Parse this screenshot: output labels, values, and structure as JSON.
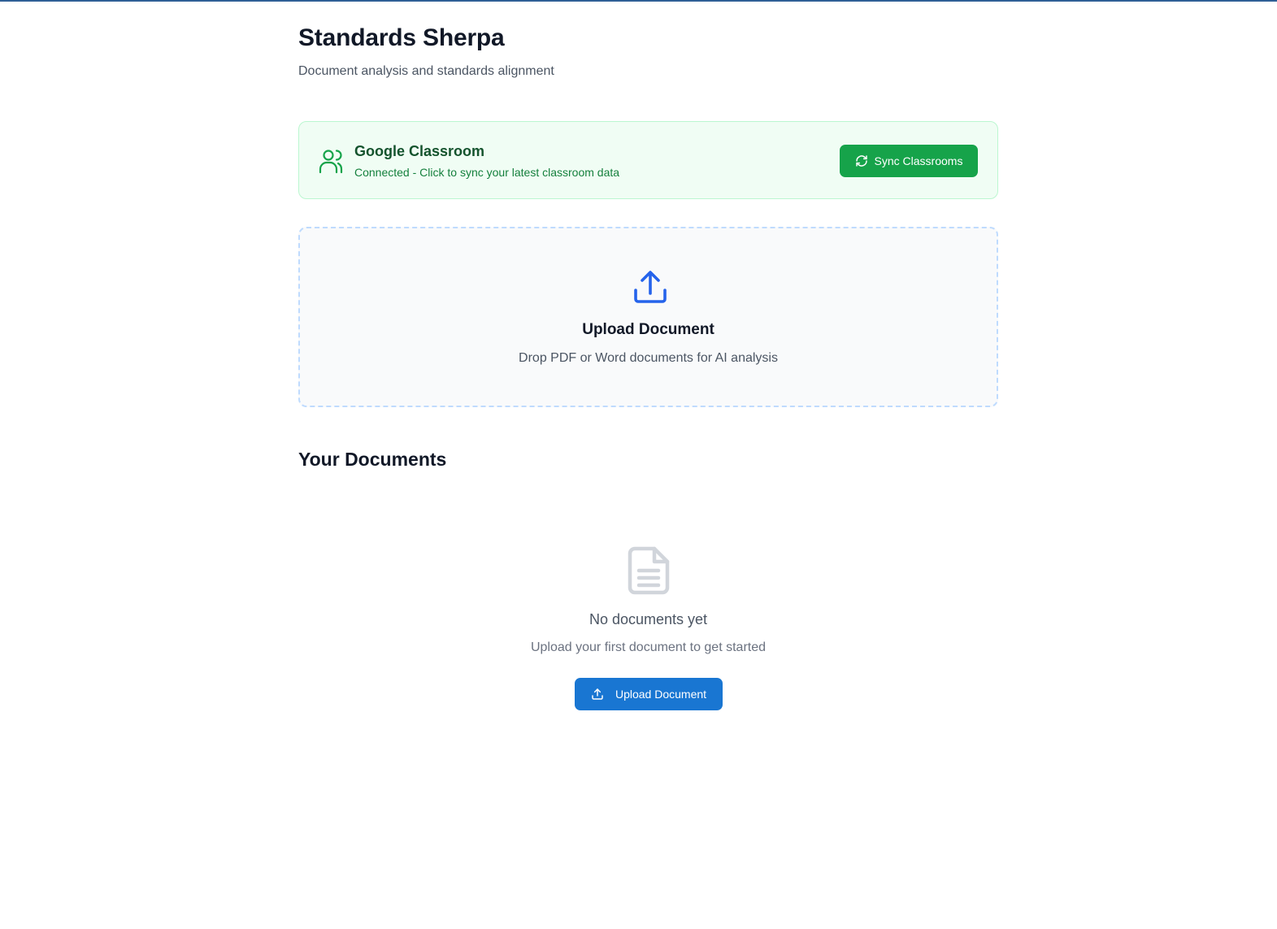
{
  "header": {
    "title": "Standards Sherpa",
    "subtitle": "Document analysis and standards alignment"
  },
  "google_classroom": {
    "title": "Google Classroom",
    "status": "Connected - Click to sync your latest classroom data",
    "sync_button_label": "Sync Classrooms",
    "icon": "users-icon",
    "sync_icon": "refresh-icon"
  },
  "upload_zone": {
    "title": "Upload Document",
    "description": "Drop PDF or Word documents for AI analysis",
    "icon": "upload-icon"
  },
  "documents": {
    "section_title": "Your Documents",
    "empty_title": "No documents yet",
    "empty_description": "Upload your first document to get started",
    "upload_button_label": "Upload Document",
    "empty_icon": "file-text-icon"
  },
  "colors": {
    "primary_blue": "#1976d2",
    "success_green": "#16a34a",
    "success_bg": "#f0fdf4",
    "success_border": "#bbf7d0",
    "text_dark": "#111827",
    "text_muted": "#4b5563"
  }
}
